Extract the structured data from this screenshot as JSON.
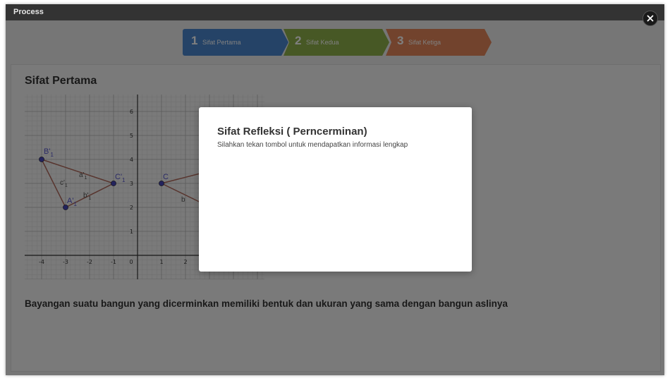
{
  "window": {
    "title": "Process"
  },
  "close": {
    "icon": "close-icon"
  },
  "steps": [
    {
      "number": "1",
      "label": "Sifat Pertama",
      "color": "#4a87cf"
    },
    {
      "number": "2",
      "label": "Sifat Kedua",
      "color": "#8fb04b"
    },
    {
      "number": "3",
      "label": "Sifat Ketiga",
      "color": "#e4875a"
    }
  ],
  "content": {
    "title": "Sifat Pertama",
    "caption": "Bayangan suatu bangun yang dicerminkan memiliki bentuk dan ukuran yang  sama dengan bangun aslinya"
  },
  "graph": {
    "x_ticks": [
      "-4",
      "-3",
      "-2",
      "-1",
      "0",
      "1",
      "2"
    ],
    "y_ticks": [
      "6",
      "5",
      "4",
      "3",
      "2",
      "1"
    ],
    "points": [
      {
        "label": "B'",
        "sub": "1",
        "x": -4,
        "y": 4
      },
      {
        "label": "C'",
        "sub": "1",
        "x": -1,
        "y": 3
      },
      {
        "label": "A'",
        "sub": "1",
        "x": -3,
        "y": 2
      },
      {
        "label": "C",
        "sub": "",
        "x": 1,
        "y": 3
      }
    ],
    "side_labels": [
      {
        "label": "c'",
        "sub": "1"
      },
      {
        "label": "a'",
        "sub": "1"
      },
      {
        "label": "b'",
        "sub": "1"
      },
      {
        "label": "b",
        "sub": ""
      }
    ],
    "colors": {
      "triangle": "#b06a5c",
      "point": "#4747b8",
      "label": "#5555cc"
    }
  },
  "modal": {
    "title": "Sifat Refleksi ( Perncerminan)",
    "text": "Silahkan tekan tombol untuk mendapatkan informasi lengkap"
  }
}
